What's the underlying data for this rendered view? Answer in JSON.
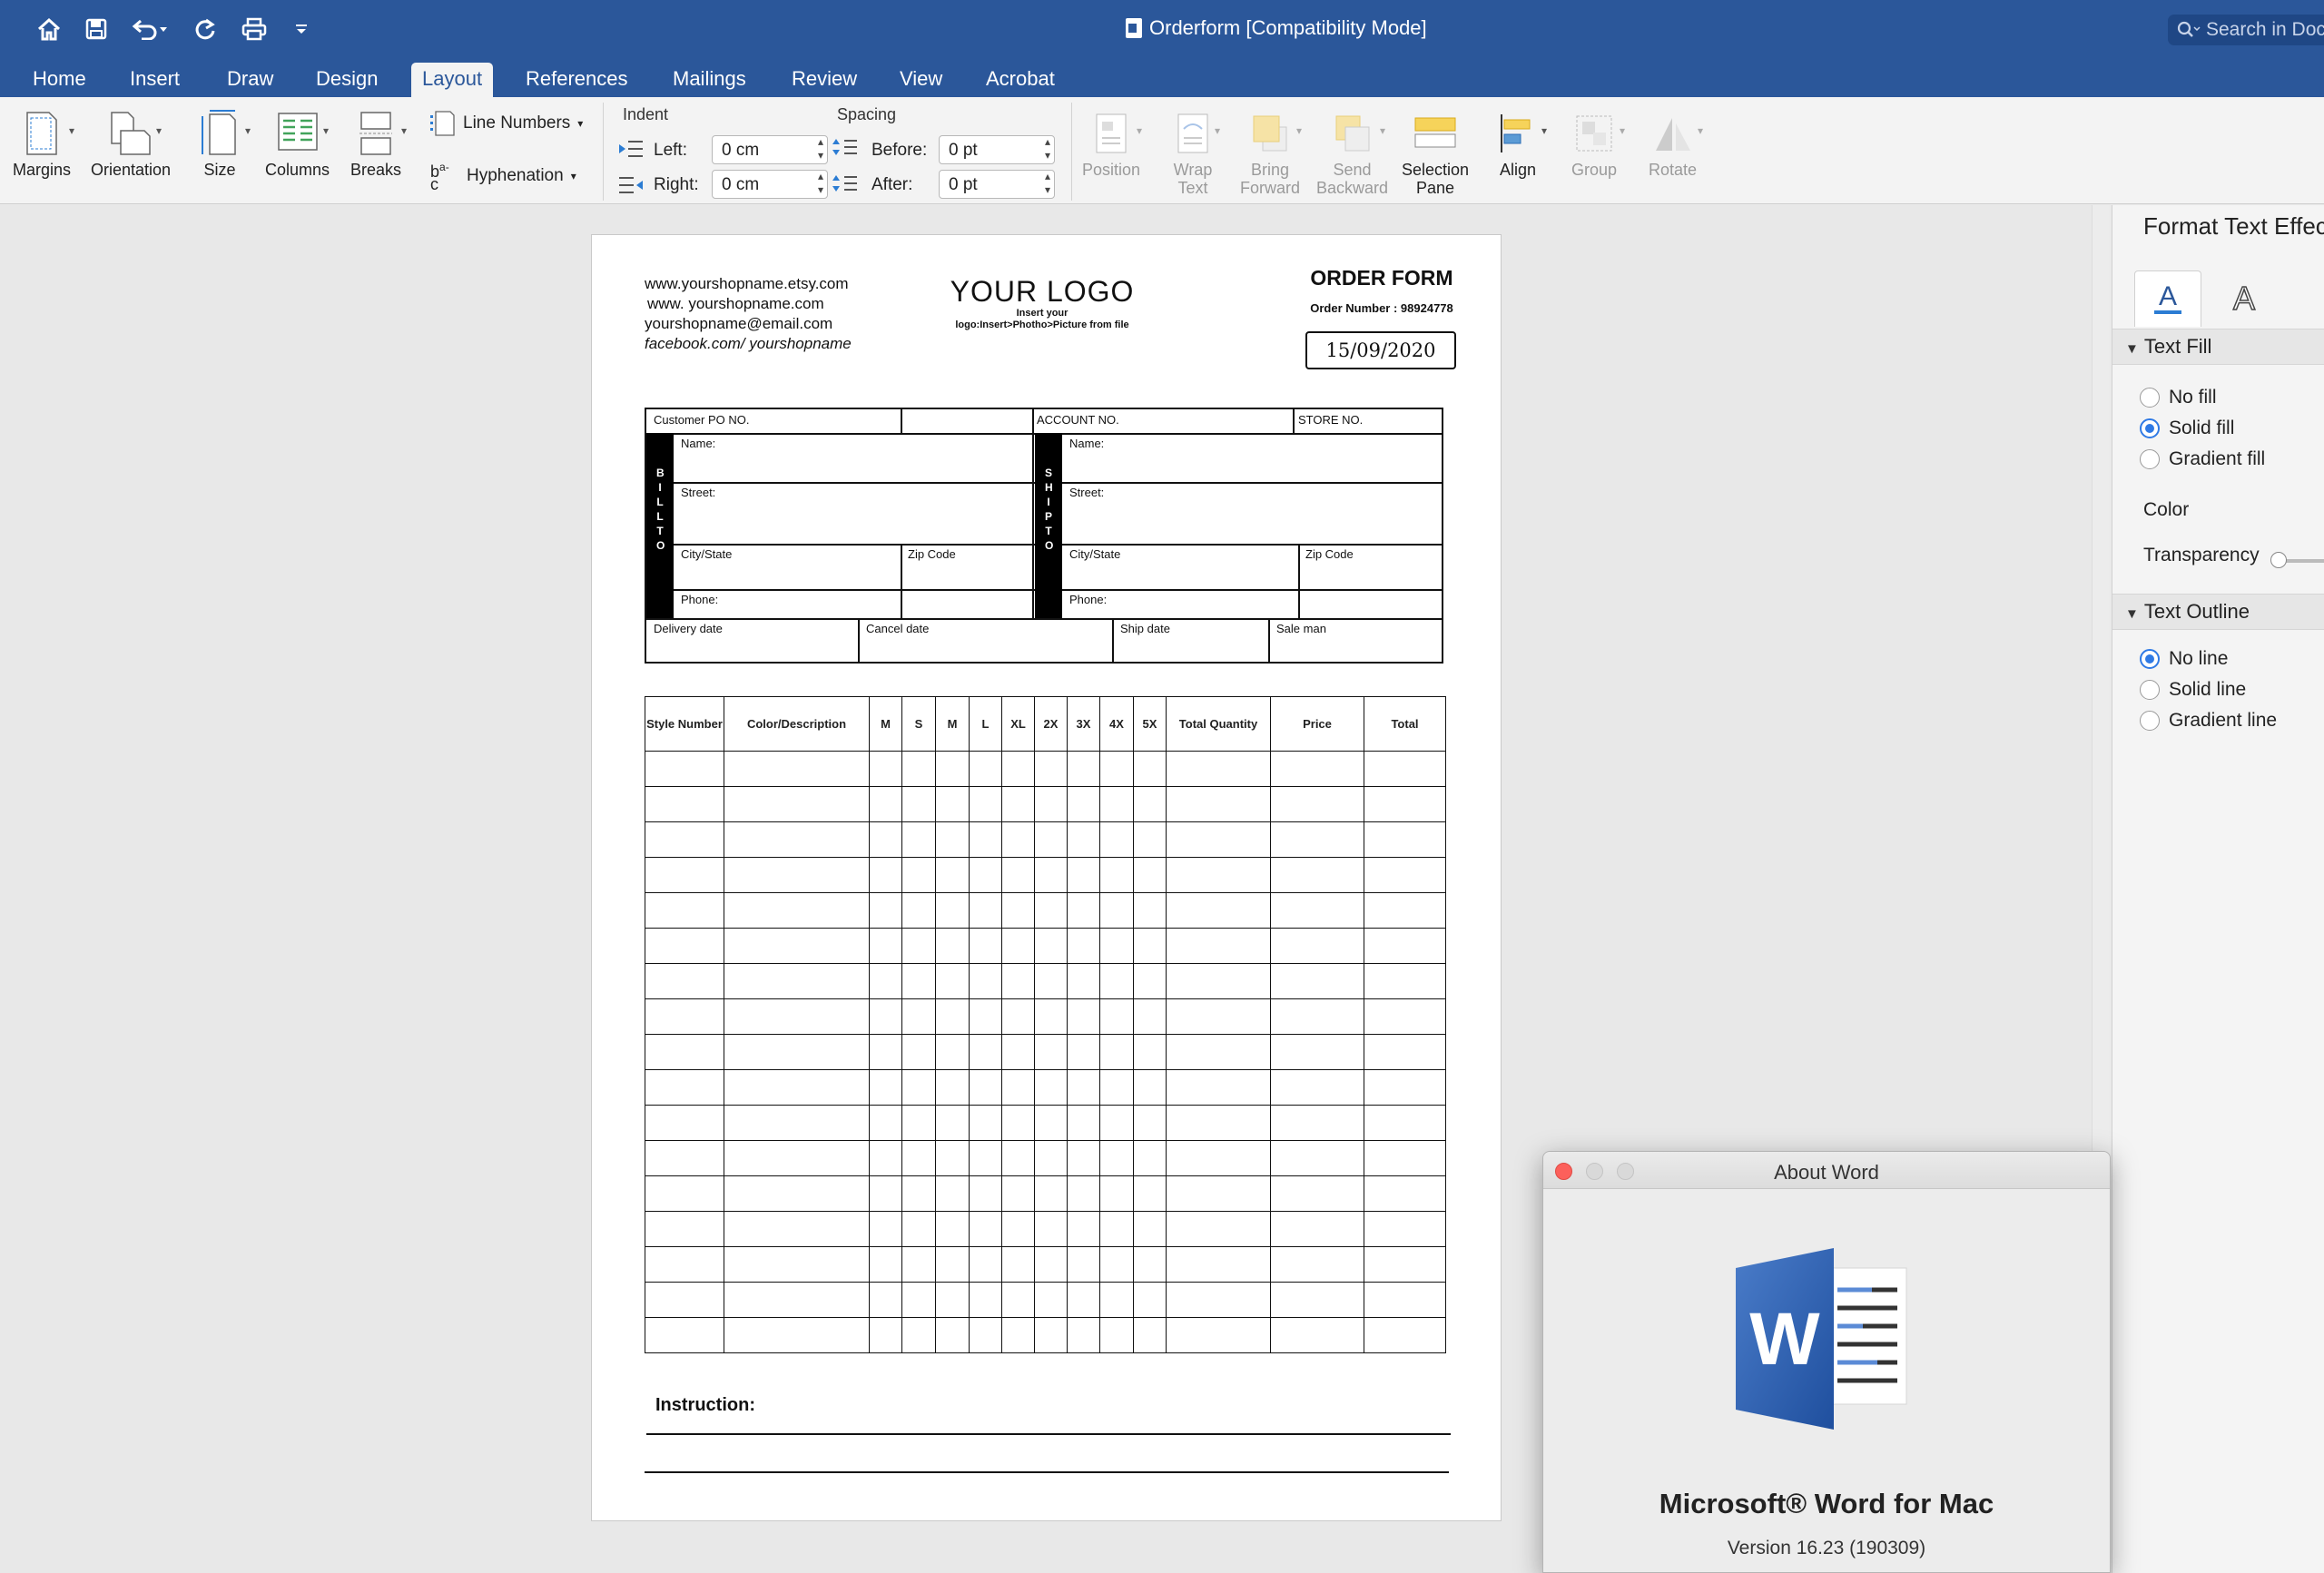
{
  "window": {
    "title": "Orderform [Compatibility Mode]",
    "search_placeholder": "Search in Doc"
  },
  "quick_access": [
    "home-icon",
    "save-icon",
    "undo-icon",
    "redo-icon",
    "print-icon",
    "customize-icon"
  ],
  "tabs": [
    {
      "label": "Home"
    },
    {
      "label": "Insert"
    },
    {
      "label": "Draw"
    },
    {
      "label": "Design"
    },
    {
      "label": "Layout",
      "active": true
    },
    {
      "label": "References"
    },
    {
      "label": "Mailings"
    },
    {
      "label": "Review"
    },
    {
      "label": "View"
    },
    {
      "label": "Acrobat"
    }
  ],
  "ribbon": {
    "margins": "Margins",
    "orientation": "Orientation",
    "size": "Size",
    "columns": "Columns",
    "breaks": "Breaks",
    "line_numbers": "Line Numbers",
    "hyphenation": "Hyphenation",
    "indent": {
      "title": "Indent",
      "left_label": "Left:",
      "left_value": "0 cm",
      "right_label": "Right:",
      "right_value": "0 cm"
    },
    "spacing": {
      "title": "Spacing",
      "before_label": "Before:",
      "before_value": "0 pt",
      "after_label": "After:",
      "after_value": "0 pt"
    },
    "arrange": {
      "position": "Position",
      "wrap_text": [
        "Wrap",
        "Text"
      ],
      "bring_forward": [
        "Bring",
        "Forward"
      ],
      "send_backward": [
        "Send",
        "Backward"
      ],
      "selection_pane": [
        "Selection",
        "Pane"
      ],
      "align": "Align",
      "group": "Group",
      "rotate": "Rotate"
    }
  },
  "document": {
    "contact": [
      "www.yourshopname.etsy.com",
      "www. yourshopname.com",
      "yourshopname@email.com",
      "facebook.com/ yourshopname"
    ],
    "logo": "YOUR LOGO",
    "logo_sub": [
      "Insert your",
      "logo:Insert>Photho>Picture from file"
    ],
    "order_title": "ORDER FORM",
    "order_number": "Order Number : 98924778",
    "order_date": "15/09/2020",
    "info": {
      "customer_po": "Customer PO NO.",
      "account_no": "ACCOUNT NO.",
      "store_no": "STORE NO.",
      "name": "Name:",
      "street": "Street:",
      "city_state": "City/State",
      "zip": "Zip Code",
      "phone": "Phone:",
      "bill_to": "BILL TO",
      "ship_to": "SHIP TO",
      "delivery_date": "Delivery date",
      "cancel_date": "Cancel date",
      "ship_date": "Ship date",
      "sale_man": "Sale man"
    },
    "table_headers": [
      "Style Number",
      "Color/Description",
      "M",
      "S",
      "M",
      "L",
      "XL",
      "2X",
      "3X",
      "4X",
      "5X",
      "Total Quantity",
      "Price",
      "Total"
    ],
    "instruction": "Instruction:"
  },
  "pane": {
    "title": "Format Text Effects",
    "text_fill": {
      "title": "Text Fill",
      "options": [
        {
          "label": "No fill",
          "selected": false
        },
        {
          "label": "Solid fill",
          "selected": true
        },
        {
          "label": "Gradient fill",
          "selected": false
        }
      ],
      "color_label": "Color",
      "transparency_label": "Transparency"
    },
    "text_outline": {
      "title": "Text Outline",
      "options": [
        {
          "label": "No line",
          "selected": true
        },
        {
          "label": "Solid line",
          "selected": false
        },
        {
          "label": "Gradient line",
          "selected": false
        }
      ]
    }
  },
  "about": {
    "title": "About Word",
    "product": "Microsoft® Word for Mac",
    "version": "Version 16.23 (190309)"
  },
  "colors": {
    "accent": "#2b579a",
    "radio_selected": "#2f7ae5",
    "close": "#fc605b"
  }
}
